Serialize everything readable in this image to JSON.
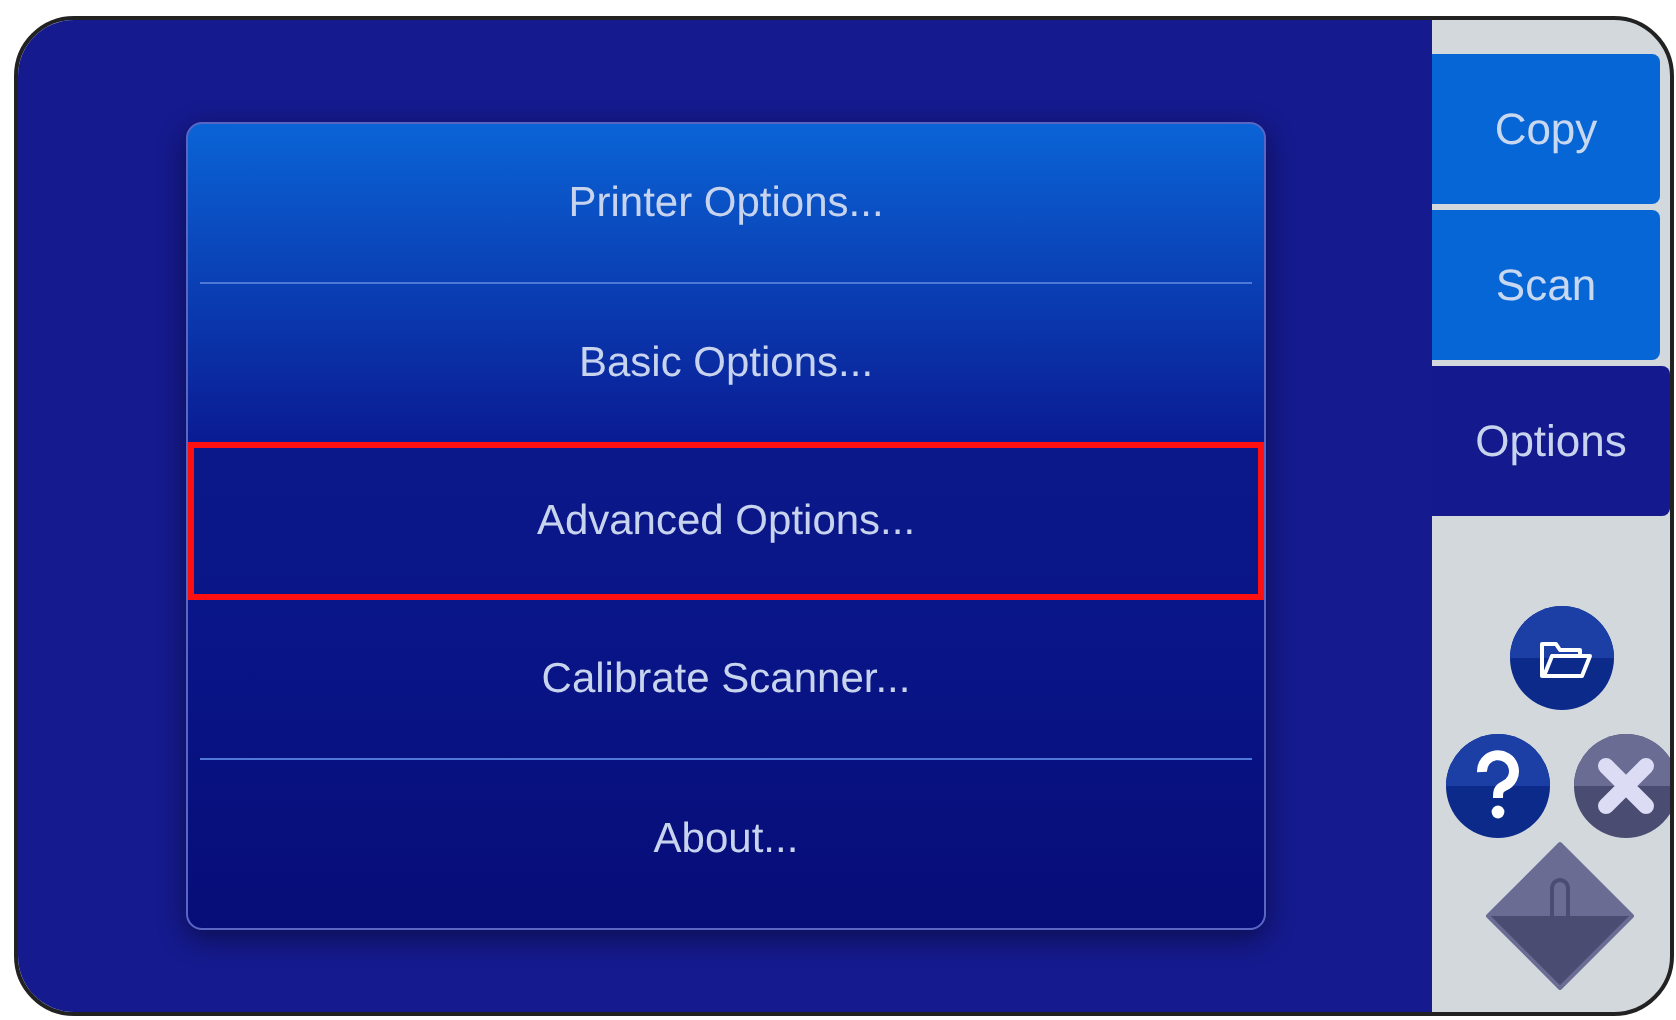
{
  "menu": [
    {
      "label": "Printer Options...",
      "selected": false
    },
    {
      "label": "Basic Options...",
      "selected": false
    },
    {
      "label": "Advanced Options...",
      "selected": true
    },
    {
      "label": "Calibrate Scanner...",
      "selected": false
    },
    {
      "label": "About...",
      "selected": false
    }
  ],
  "tabs": [
    {
      "label": "Copy",
      "selected": false
    },
    {
      "label": "Scan",
      "selected": false
    },
    {
      "label": "Options",
      "selected": true
    }
  ],
  "tools": [
    {
      "kind": "folder",
      "disabled": false
    },
    {
      "kind": "help",
      "disabled": false
    },
    {
      "kind": "close",
      "disabled": true
    },
    {
      "kind": "start",
      "disabled": true
    }
  ]
}
